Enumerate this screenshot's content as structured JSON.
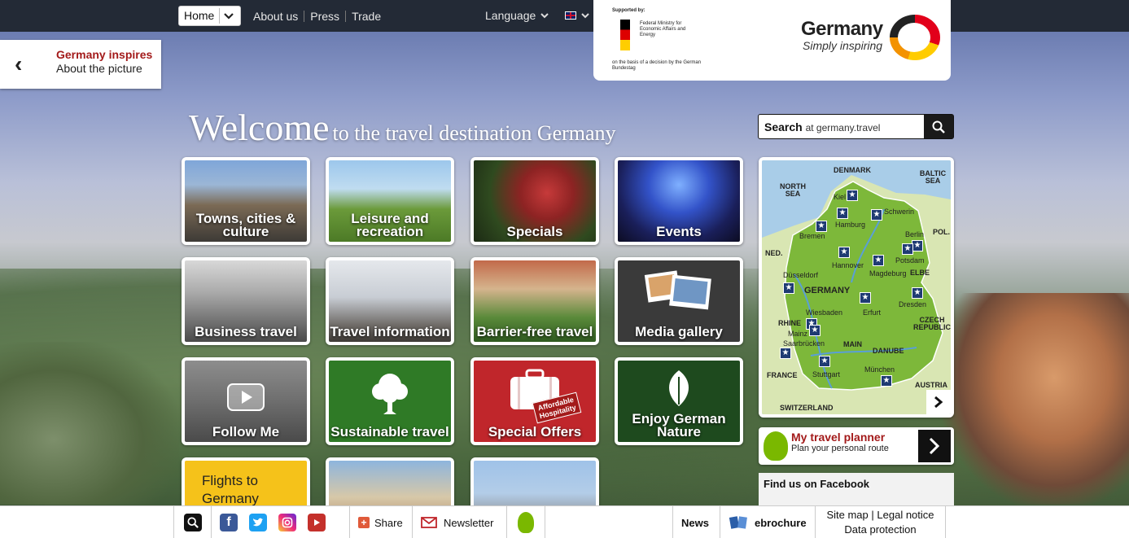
{
  "topnav": {
    "home_label": "Home",
    "items": [
      "About us",
      "Press",
      "Trade"
    ],
    "language_label": "Language"
  },
  "sponsor": {
    "supported_by": "Supported by:",
    "ministry": "Federal Ministry for Economic Affairs and Energy",
    "basis": "on the basis of a decision by the German Bundestag",
    "brand_title": "Germany",
    "brand_sub": "Simply inspiring"
  },
  "inspires": {
    "title": "Germany inspires",
    "subtitle": "About the picture"
  },
  "welcome": {
    "big": "Welcome",
    "small": "to the travel destination Germany"
  },
  "search": {
    "label": "Search",
    "suffix": "at germany.travel"
  },
  "tiles": [
    {
      "label": "Towns, cities & culture"
    },
    {
      "label": "Leisure and recreation"
    },
    {
      "label": "Specials"
    },
    {
      "label": "Events"
    },
    {
      "label": "Business travel"
    },
    {
      "label": "Travel information"
    },
    {
      "label": "Barrier-free travel"
    },
    {
      "label": "Media gallery"
    },
    {
      "label": "Follow Me"
    },
    {
      "label": "Sustainable travel"
    },
    {
      "label": "Special Offers",
      "badge": "Affordable Hospitality"
    },
    {
      "label": "Enjoy German Nature"
    },
    {
      "label": "Flights to Germany"
    }
  ],
  "map": {
    "labels": [
      "DENMARK",
      "BALTIC SEA",
      "NORTH SEA",
      "NED.",
      "POL.",
      "GERMANY",
      "CZECH REPUBLIC",
      "FRANCE",
      "AUSTRIA",
      "SWITZERLAND",
      "RHINE",
      "MAIN",
      "DANUBE",
      "ELBE"
    ],
    "cities": [
      "Kiel",
      "Hamburg",
      "Schwerin",
      "Bremen",
      "Berlin",
      "Potsdam",
      "Hannover",
      "Magdeburg",
      "Düsseldorf",
      "Dresden",
      "Erfurt",
      "Wiesbaden",
      "Mainz",
      "Saarbrücken",
      "Stuttgart",
      "München"
    ]
  },
  "planner": {
    "title": "My travel planner",
    "subtitle": "Plan your personal route"
  },
  "facebook": {
    "title": "Find us on Facebook"
  },
  "bottombar": {
    "share": "Share",
    "newsletter": "Newsletter",
    "news": "News",
    "ebrochure": "ebrochure",
    "sitemap": "Site map",
    "legal": "Legal notice",
    "privacy": "Data protection"
  }
}
